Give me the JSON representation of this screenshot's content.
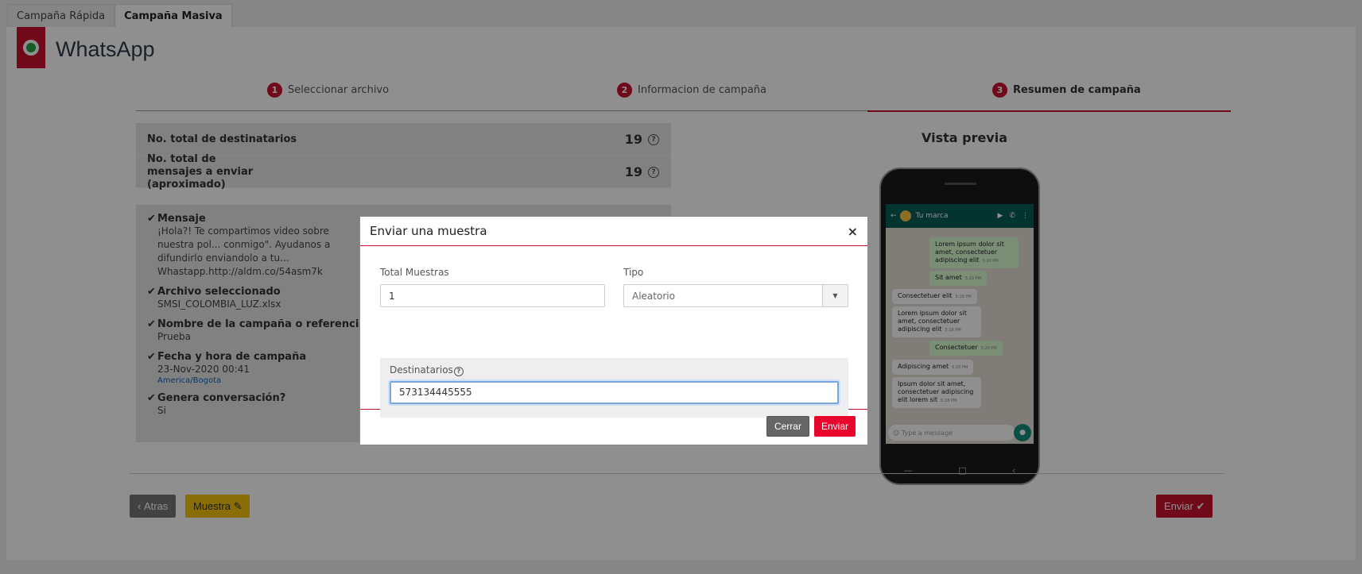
{
  "tabs": [
    "Campaña Rápida",
    "Campaña Masiva"
  ],
  "page": {
    "title": "WhatsApp"
  },
  "steps": [
    {
      "num": "1",
      "label": "Seleccionar archivo"
    },
    {
      "num": "2",
      "label": "Informacion de campaña"
    },
    {
      "num": "3",
      "label": "Resumen de campaña"
    }
  ],
  "summary": {
    "recipients_label": "No. total de destinatarios",
    "recipients_value": "19",
    "messages_label": "No. total de mensajes a enviar (aproximado)",
    "messages_value": "19"
  },
  "details": {
    "message_title": "Mensaje",
    "message_text": "¡Hola?! Te compartimos video sobre nuestra pol... conmigo\". Ayudanos a difundirlo enviandolo a tu... Whastapp.http://aldm.co/54asm7k",
    "file_title": "Archivo seleccionado",
    "file_value": "SMSI_COLOMBIA_LUZ.xlsx",
    "campaign_name_title": "Nombre de la campaña o referencia",
    "campaign_name_value": "Prueba",
    "datetime_title": "Fecha y hora de campaña",
    "datetime_value": "23-Nov-2020 00:41",
    "timezone": "America/Bogota",
    "conversation_title": "Genera conversación?",
    "conversation_value": "Si"
  },
  "preview": {
    "title": "Vista previa",
    "brand": "Tu marca",
    "messages": [
      {
        "dir": "out",
        "text": "Lorem ipsum dolor sit amet, consectetuer adipiscing elit",
        "time": "5:20 PM"
      },
      {
        "dir": "out",
        "text": "Sit amet",
        "time": "5:20 PM"
      },
      {
        "dir": "in",
        "text": "Consectetuer elit",
        "time": "5:18 PM"
      },
      {
        "dir": "in",
        "text": "Lorem ipsum dolor sit amet, consectetuer adipiscing elit",
        "time": "5:18 PM"
      },
      {
        "dir": "out",
        "text": "Consectetuer",
        "time": "5:20 PM"
      },
      {
        "dir": "in",
        "text": "Adipiscing amet",
        "time": "5:20 PM"
      },
      {
        "dir": "in",
        "text": "Ipsum dolor sit amet, consectetuer adipiscing elit lorem sit",
        "time": "5:18 PM"
      }
    ],
    "compose_placeholder": "Type a message"
  },
  "buttons": {
    "atras": "Atras",
    "muestra": "Muestra",
    "enviar": "Enviar"
  },
  "modal": {
    "title": "Enviar una muestra",
    "close": "×",
    "total_label": "Total Muestras",
    "total_value": "1",
    "tipo_label": "Tipo",
    "tipo_value": "Aleatorio",
    "dest_label": "Destinatarios",
    "dest_value": "573134445555",
    "cerrar": "Cerrar",
    "enviar": "Enviar"
  },
  "colors": {
    "brand": "#c8102e",
    "warning": "#f4c20d",
    "whatsapp": "#075e54"
  }
}
